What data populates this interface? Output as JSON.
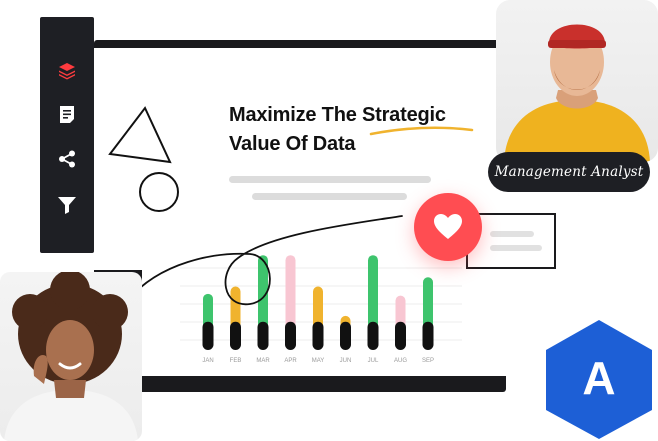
{
  "headline": {
    "line1_a": "Maximize The ",
    "line1_b": "Strategic",
    "line2": "Value Of Data"
  },
  "role_tag": "Management Analyst",
  "sidebar": {
    "icons": [
      "layers-icon",
      "document-icon",
      "share-icon",
      "filter-icon"
    ],
    "accent": "#ff3b3f"
  },
  "colors": {
    "accent_red": "#ff4d52",
    "green": "#3ec46d",
    "yellow": "#f0b32e",
    "pink": "#f8c6d2",
    "underline": "#f0b32e",
    "logo_blue": "#1d5fd6"
  },
  "chart_data": {
    "type": "bar",
    "categories": [
      "JAN",
      "FEB",
      "MAR",
      "APR",
      "MAY",
      "JUN",
      "JUL",
      "AUG",
      "SEP"
    ],
    "series": [
      {
        "values": [
          48,
          56,
          90,
          90,
          56,
          24,
          90,
          46,
          66
        ]
      },
      {
        "values": [
          22,
          22,
          22,
          22,
          22,
          22,
          22,
          22,
          22
        ]
      }
    ],
    "colors": [
      "#3ec46d",
      "#f0b32e",
      "#3ec46d",
      "#f8c6d2",
      "#f0b32e",
      "#f0b32e",
      "#3ec46d",
      "#f8c6d2",
      "#3ec46d"
    ],
    "grid": true,
    "legend": "none"
  },
  "logo": {
    "letter": "A"
  }
}
